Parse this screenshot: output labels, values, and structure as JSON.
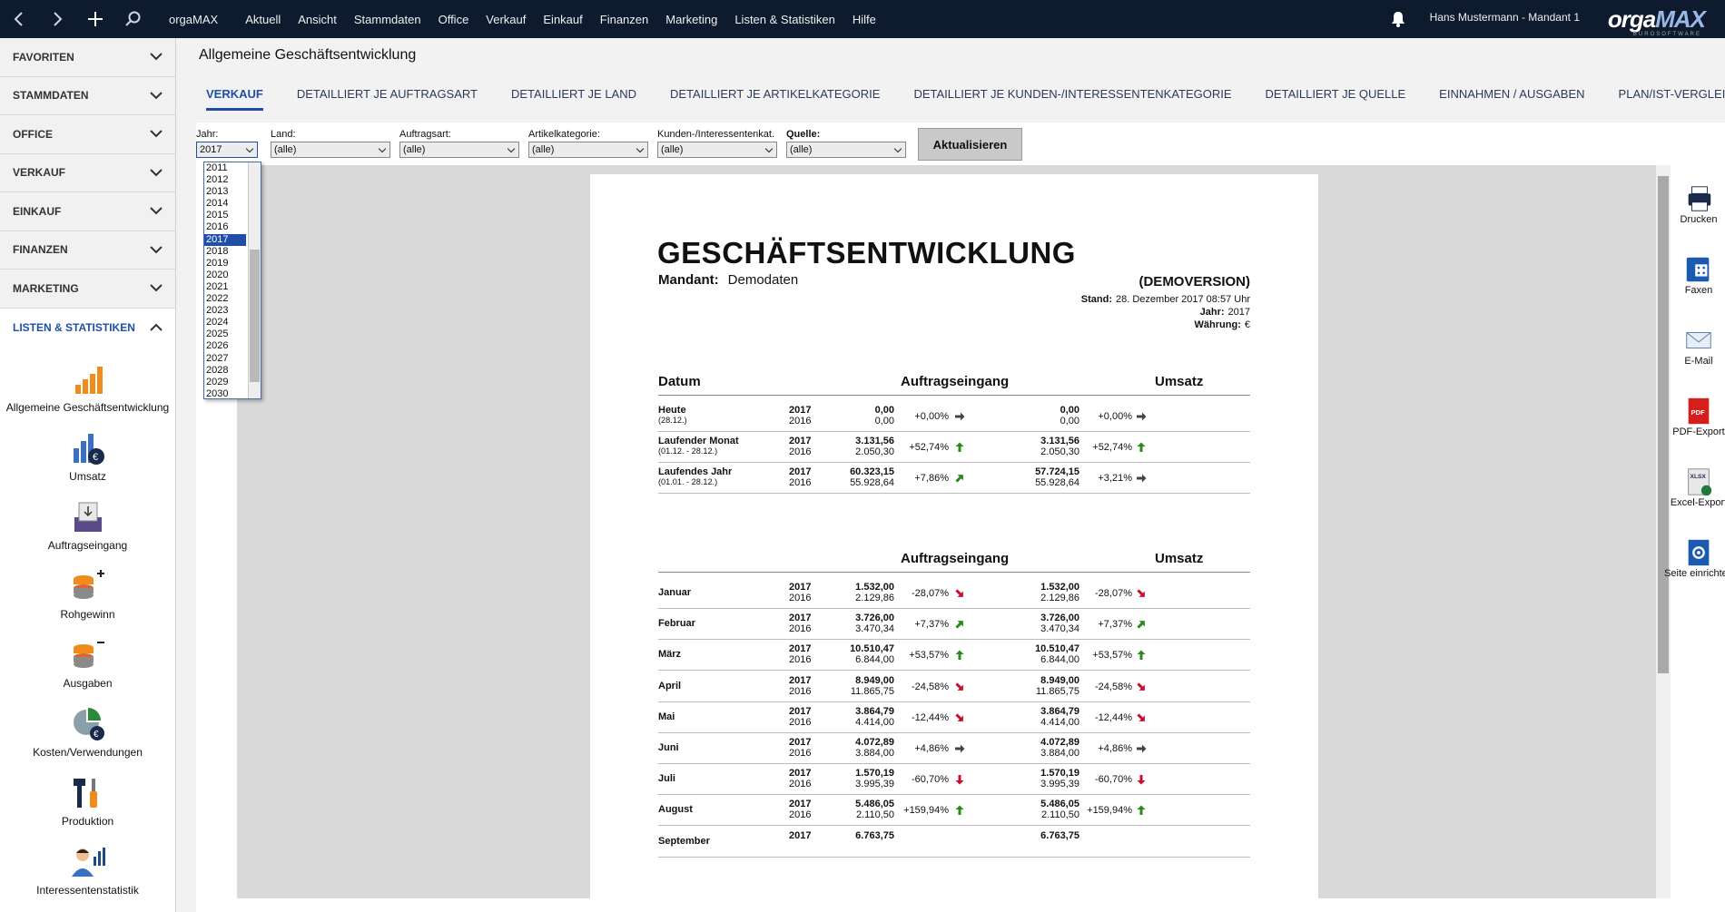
{
  "topbar": {
    "menu": [
      "orgaMAX",
      "Aktuell",
      "Ansicht",
      "Stammdaten",
      "Office",
      "Verkauf",
      "Einkauf",
      "Finanzen",
      "Marketing",
      "Listen & Statistiken",
      "Hilfe"
    ],
    "user": "Hans Mustermann - Mandant 1",
    "logo": "orgaMAX",
    "logo_sub": "BUROSOFTWARE"
  },
  "sidebar": {
    "sections": [
      "FAVORITEN",
      "STAMMDATEN",
      "OFFICE",
      "VERKAUF",
      "EINKAUF",
      "FINANZEN",
      "MARKETING",
      "LISTEN & STATISTIKEN"
    ],
    "tools": [
      "Allgemeine Geschäftsentwicklung",
      "Umsatz",
      "Auftragseingang",
      "Rohgewinn",
      "Ausgaben",
      "Kosten/Verwendungen",
      "Produktion",
      "Interessentenstatistik"
    ]
  },
  "page": {
    "title": "Allgemeine Geschäftsentwicklung",
    "tabs": [
      "VERKAUF",
      "DETAILLIERT JE AUFTRAGSART",
      "DETAILLIERT JE LAND",
      "DETAILLIERT JE ARTIKELKATEGORIE",
      "DETAILLIERT JE KUNDEN-/INTERESSENTENKATEGORIE",
      "DETAILLIERT JE QUELLE",
      "EINNAHMEN / AUSGABEN",
      "PLAN/IST-VERGLEICH"
    ]
  },
  "filters": {
    "jahr_label": "Jahr:",
    "jahr_value": "2017",
    "land_label": "Land:",
    "land_value": "(alle)",
    "auftragsart_label": "Auftragsart:",
    "auftragsart_value": "(alle)",
    "artikel_label": "Artikelkategorie:",
    "artikel_value": "(alle)",
    "kunden_label": "Kunden-/Interessentenkat.",
    "kunden_value": "(alle)",
    "quelle_label": "Quelle:",
    "quelle_value": "(alle)",
    "refresh": "Aktualisieren",
    "years": [
      "2011",
      "2012",
      "2013",
      "2014",
      "2015",
      "2016",
      "2017",
      "2018",
      "2019",
      "2020",
      "2021",
      "2022",
      "2023",
      "2024",
      "2025",
      "2026",
      "2027",
      "2028",
      "2029",
      "2030"
    ]
  },
  "report": {
    "title": "GESCHÄFTSENTWICKLUNG",
    "mandant_label": "Mandant:",
    "mandant": "Demodaten",
    "demo": "(DEMOVERSION)",
    "stand_label": "Stand:",
    "stand": "28. Dezember 2017 08:57 Uhr",
    "jahr_label": "Jahr:",
    "jahr": "2017",
    "waehrung_label": "Währung:",
    "waehrung": "€",
    "h_datum": "Datum",
    "h_auftrag": "Auftragseingang",
    "h_umsatz": "Umsatz",
    "summary": [
      {
        "label": "Heute",
        "sub": "(28.12.)",
        "y1": "2017",
        "y2": "2016",
        "a1": "0,00",
        "a2": "0,00",
        "ap": "+0,00%",
        "u1": "0,00",
        "u2": "0,00",
        "up": "+0,00%",
        "ad": "flat",
        "ud": "flat"
      },
      {
        "label": "Laufender Monat",
        "sub": "(01.12. - 28.12.)",
        "y1": "2017",
        "y2": "2016",
        "a1": "3.131,56",
        "a2": "2.050,30",
        "ap": "+52,74%",
        "u1": "3.131,56",
        "u2": "2.050,30",
        "up": "+52,74%",
        "ad": "up",
        "ud": "up"
      },
      {
        "label": "Laufendes Jahr",
        "sub": "(01.01. - 28.12.)",
        "y1": "2017",
        "y2": "2016",
        "a1": "60.323,15",
        "a2": "55.928,64",
        "ap": "+7,86%",
        "u1": "57.724,15",
        "u2": "55.928,64",
        "up": "+3,21%",
        "ad": "upright",
        "ud": "flat"
      }
    ],
    "months": [
      {
        "label": "Januar",
        "y1": "2017",
        "y2": "2016",
        "a1": "1.532,00",
        "a2": "2.129,86",
        "ap": "-28,07%",
        "u1": "1.532,00",
        "u2": "2.129,86",
        "up": "-28,07%",
        "ad": "downright",
        "ud": "downright"
      },
      {
        "label": "Februar",
        "y1": "2017",
        "y2": "2016",
        "a1": "3.726,00",
        "a2": "3.470,34",
        "ap": "+7,37%",
        "u1": "3.726,00",
        "u2": "3.470,34",
        "up": "+7,37%",
        "ad": "upright",
        "ud": "upright"
      },
      {
        "label": "März",
        "y1": "2017",
        "y2": "2016",
        "a1": "10.510,47",
        "a2": "6.844,00",
        "ap": "+53,57%",
        "u1": "10.510,47",
        "u2": "6.844,00",
        "up": "+53,57%",
        "ad": "up",
        "ud": "up"
      },
      {
        "label": "April",
        "y1": "2017",
        "y2": "2016",
        "a1": "8.949,00",
        "a2": "11.865,75",
        "ap": "-24,58%",
        "u1": "8.949,00",
        "u2": "11.865,75",
        "up": "-24,58%",
        "ad": "downright",
        "ud": "downright"
      },
      {
        "label": "Mai",
        "y1": "2017",
        "y2": "2016",
        "a1": "3.864,79",
        "a2": "4.414,00",
        "ap": "-12,44%",
        "u1": "3.864,79",
        "u2": "4.414,00",
        "up": "-12,44%",
        "ad": "downright",
        "ud": "downright"
      },
      {
        "label": "Juni",
        "y1": "2017",
        "y2": "2016",
        "a1": "4.072,89",
        "a2": "3.884,00",
        "ap": "+4,86%",
        "u1": "4.072,89",
        "u2": "3.884,00",
        "up": "+4,86%",
        "ad": "flat",
        "ud": "flat"
      },
      {
        "label": "Juli",
        "y1": "2017",
        "y2": "2016",
        "a1": "1.570,19",
        "a2": "3.995,39",
        "ap": "-60,70%",
        "u1": "1.570,19",
        "u2": "3.995,39",
        "up": "-60,70%",
        "ad": "down",
        "ud": "down"
      },
      {
        "label": "August",
        "y1": "2017",
        "y2": "2016",
        "a1": "5.486,05",
        "a2": "2.110,50",
        "ap": "+159,94%",
        "u1": "5.486,05",
        "u2": "2.110,50",
        "up": "+159,94%",
        "ad": "up",
        "ud": "up"
      },
      {
        "label": "September",
        "y1": "2017",
        "y2": "",
        "a1": "6.763,75",
        "a2": "",
        "ap": "",
        "u1": "6.763,75",
        "u2": "",
        "up": "",
        "ad": "none",
        "ud": "none"
      }
    ]
  },
  "righttools": [
    "Drucken",
    "Faxen",
    "E-Mail",
    "PDF-Export",
    "Excel-Export",
    "Seite einrichten"
  ],
  "colors": {
    "accent": "#1f4fa8",
    "topbar": "#0e1a2e",
    "up": "#2a8a1a",
    "down": "#c8102e",
    "flat": "#444444"
  }
}
